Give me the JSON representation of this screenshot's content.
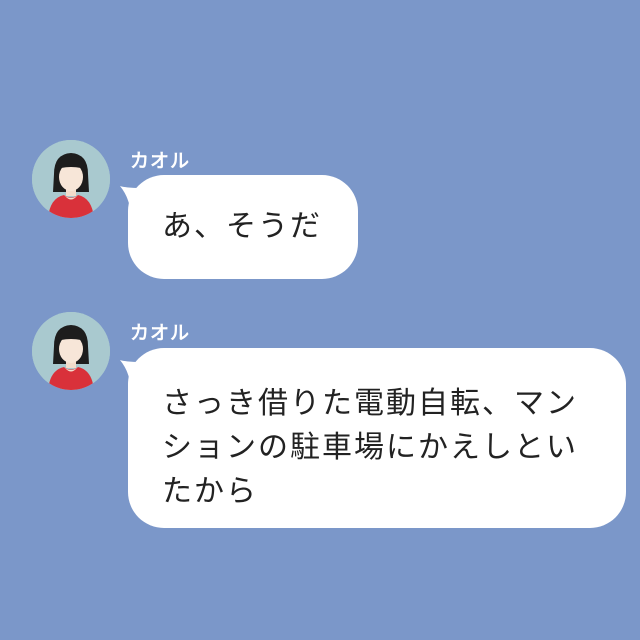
{
  "chat": {
    "background_color": "#7b97c9",
    "messages": [
      {
        "sender": "カオル",
        "avatar_icon": "woman-avatar-icon",
        "text": "あ、そうだ"
      },
      {
        "sender": "カオル",
        "avatar_icon": "woman-avatar-icon",
        "text": "さっき借りた電動自転、マンションの駐車場にかえしといたから"
      }
    ]
  }
}
